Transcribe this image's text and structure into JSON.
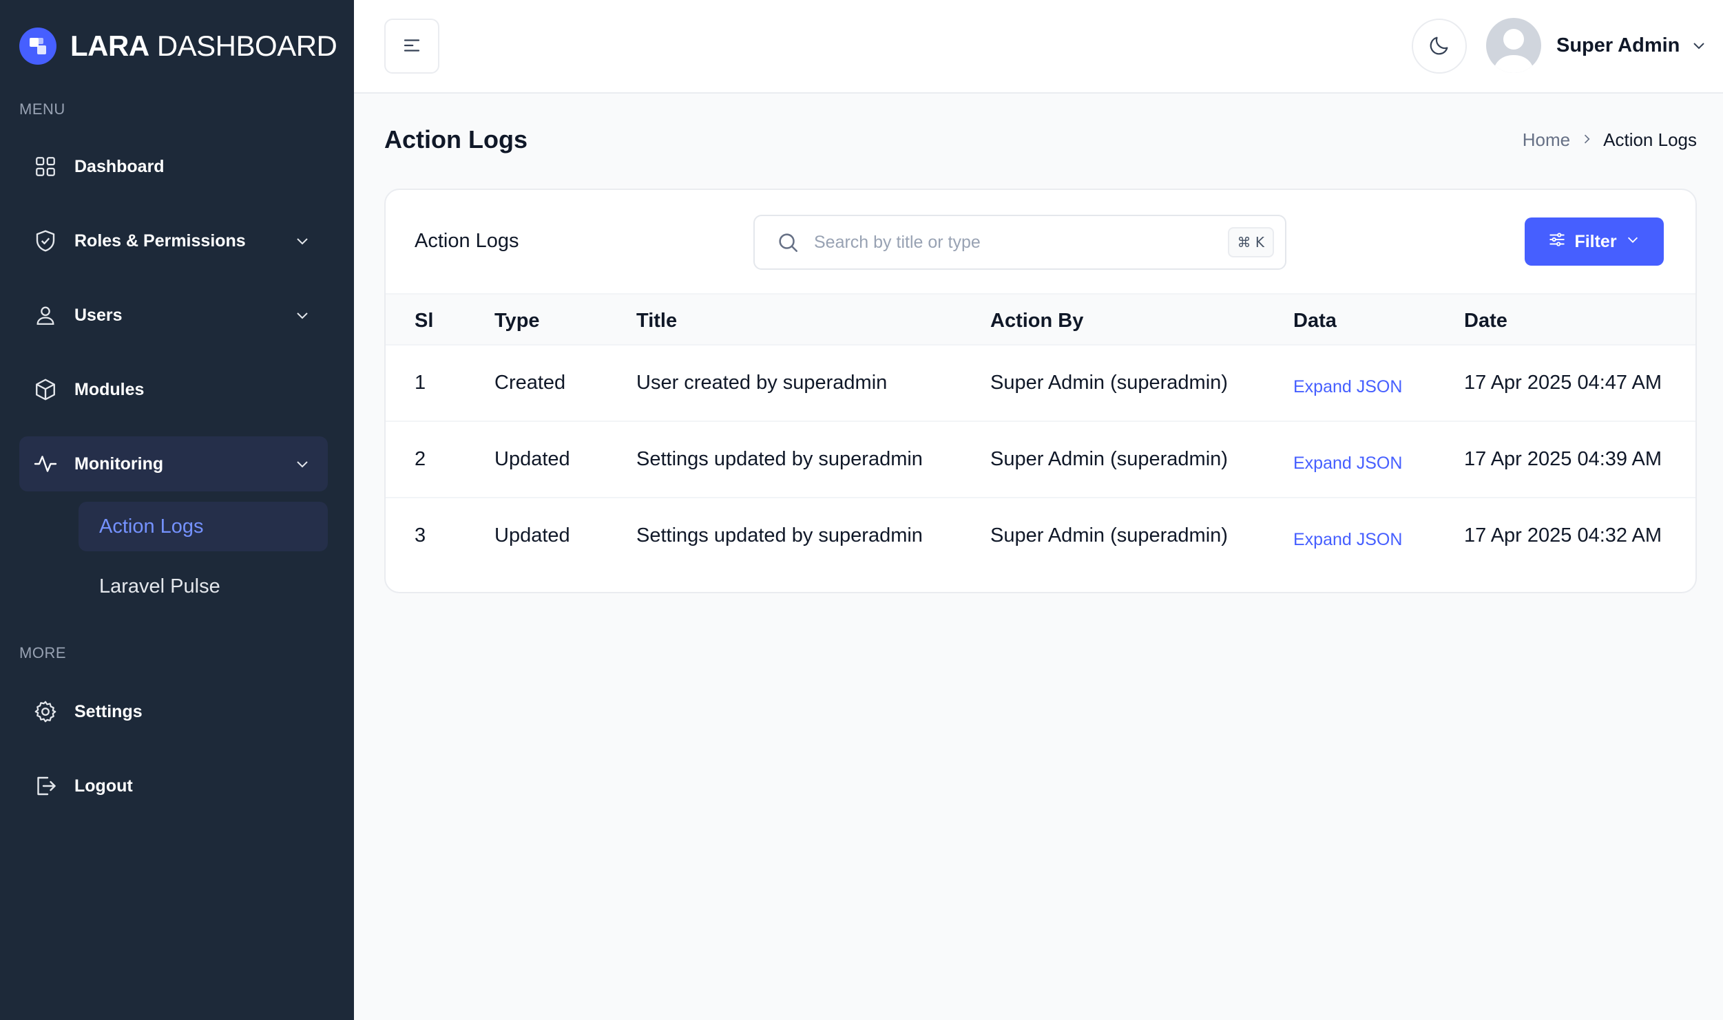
{
  "brand": {
    "name_bold": "LARA",
    "name_light": "DASHBOARD",
    "color": "#465fff"
  },
  "sidebar": {
    "menu_heading": "MENU",
    "more_heading": "MORE",
    "items": [
      {
        "label": "Dashboard",
        "icon": "grid-icon"
      },
      {
        "label": "Roles & Permissions",
        "icon": "shield-icon"
      },
      {
        "label": "Users",
        "icon": "user-icon"
      },
      {
        "label": "Modules",
        "icon": "box-icon"
      },
      {
        "label": "Monitoring",
        "icon": "activity-icon"
      }
    ],
    "monitoring_children": [
      {
        "label": "Action Logs"
      },
      {
        "label": "Laravel Pulse"
      }
    ],
    "more_items": [
      {
        "label": "Settings",
        "icon": "gear-icon"
      },
      {
        "label": "Logout",
        "icon": "logout-icon"
      }
    ]
  },
  "header": {
    "user_name": "Super Admin"
  },
  "page": {
    "title": "Action Logs",
    "breadcrumb": {
      "home": "Home",
      "current": "Action Logs"
    }
  },
  "card": {
    "title": "Action Logs",
    "search": {
      "placeholder": "Search by title or type",
      "shortcut": "⌘ K"
    },
    "filter_label": "Filter"
  },
  "table": {
    "columns": [
      "Sl",
      "Type",
      "Title",
      "Action By",
      "Data",
      "Date"
    ],
    "rows": [
      {
        "sl": "1",
        "type": "Created",
        "title": "User created by superadmin",
        "action_by": "Super Admin (superadmin)",
        "data": "Expand JSON",
        "date": "17 Apr 2025 04:47 AM"
      },
      {
        "sl": "2",
        "type": "Updated",
        "title": "Settings updated by superadmin",
        "action_by": "Super Admin (superadmin)",
        "data": "Expand JSON",
        "date": "17 Apr 2025 04:39 AM"
      },
      {
        "sl": "3",
        "type": "Updated",
        "title": "Settings updated by superadmin",
        "action_by": "Super Admin (superadmin)",
        "data": "Expand JSON",
        "date": "17 Apr 2025 04:32 AM"
      }
    ]
  }
}
